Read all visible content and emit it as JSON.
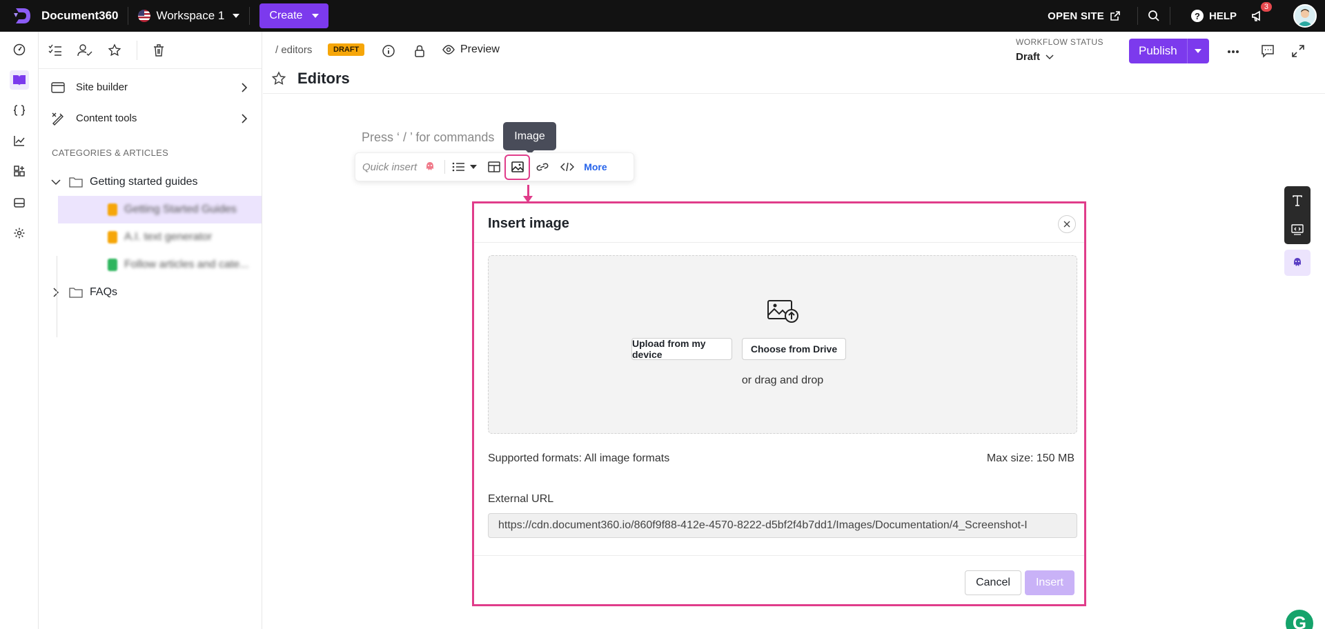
{
  "topbar": {
    "brand": "Document360",
    "workspace": "Workspace 1",
    "create_label": "Create",
    "open_site": "OPEN SITE",
    "help": "HELP",
    "notifications_count": "3"
  },
  "sidebar": {
    "items": [
      {
        "label": "Site builder"
      },
      {
        "label": "Content tools"
      }
    ],
    "categories_header": "CATEGORIES & ARTICLES",
    "tree": {
      "folder1": "Getting started guides",
      "articles": [
        "Getting Started Guides",
        "A.I. text generator",
        "Follow articles and cate..."
      ],
      "folder2": "FAQs"
    }
  },
  "header": {
    "breadcrumb": "/ editors",
    "status_badge": "DRAFT",
    "preview": "Preview",
    "title": "Editors",
    "workflow_label": "WORKFLOW STATUS",
    "workflow_value": "Draft",
    "publish": "Publish"
  },
  "editor": {
    "placeholder": "Press ‘ / ’ for commands",
    "tooltip": "Image",
    "quick_insert": "Quick insert",
    "more": "More"
  },
  "modal": {
    "title": "Insert image",
    "upload_btn": "Upload from my device",
    "drive_btn": "Choose from Drive",
    "drag_text": "or drag and drop",
    "formats": "Supported formats: All image formats",
    "max_size": "Max size: 150 MB",
    "ext_label": "External URL",
    "ext_value": "https://cdn.document360.io/860f9f88-412e-4570-8222-d5bf2f4b7dd1/Images/Documentation/4_Screenshot-I",
    "cancel": "Cancel",
    "insert": "Insert"
  },
  "colors": {
    "accent": "#7c3aed",
    "highlight": "#e03c8a",
    "draft": "#f6a609"
  }
}
